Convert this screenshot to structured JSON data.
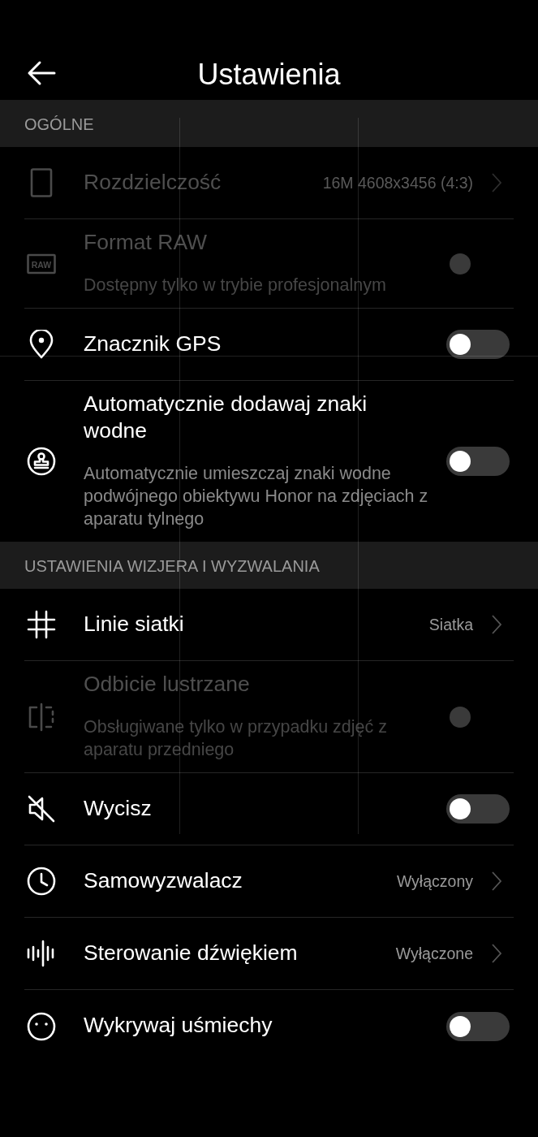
{
  "header": {
    "title": "Ustawienia"
  },
  "sections": [
    {
      "title": "OGÓLNE",
      "items": [
        {
          "kind": "nav",
          "title": "Rozdzielczość",
          "value": "16M 4608x3456 (4:3)",
          "disabled": true
        },
        {
          "kind": "toggle",
          "title": "Format RAW",
          "icon_text": "RAW",
          "subtitle": "Dostępny tylko w trybie profesjonalnym",
          "disabled": true
        },
        {
          "kind": "toggle",
          "title": "Znacznik GPS",
          "disabled": false,
          "on": false
        },
        {
          "kind": "toggle",
          "title": "Automatycznie dodawaj znaki wodne",
          "subtitle": "Automatycznie umieszczaj znaki wodne podwójnego obiektywu Honor na zdjęciach z aparatu tylnego",
          "disabled": false,
          "on": false
        }
      ]
    },
    {
      "title": "USTAWIENIA WIZJERA I WYZWALANIA",
      "items": [
        {
          "kind": "nav",
          "title": "Linie siatki",
          "value": "Siatka",
          "disabled": false
        },
        {
          "kind": "toggle",
          "title": "Odbicie lustrzane",
          "subtitle": "Obsługiwane tylko w przypadku zdjęć z aparatu przedniego",
          "disabled": true
        },
        {
          "kind": "toggle",
          "title": "Wycisz",
          "disabled": false,
          "on": false
        },
        {
          "kind": "nav",
          "title": "Samowyzwalacz",
          "value": "Wyłączony",
          "disabled": false
        },
        {
          "kind": "nav",
          "title": "Sterowanie dźwiękiem",
          "value": "Wyłączone",
          "disabled": false
        },
        {
          "kind": "toggle",
          "title": "Wykrywaj uśmiechy",
          "disabled": false,
          "on": false
        }
      ]
    }
  ]
}
